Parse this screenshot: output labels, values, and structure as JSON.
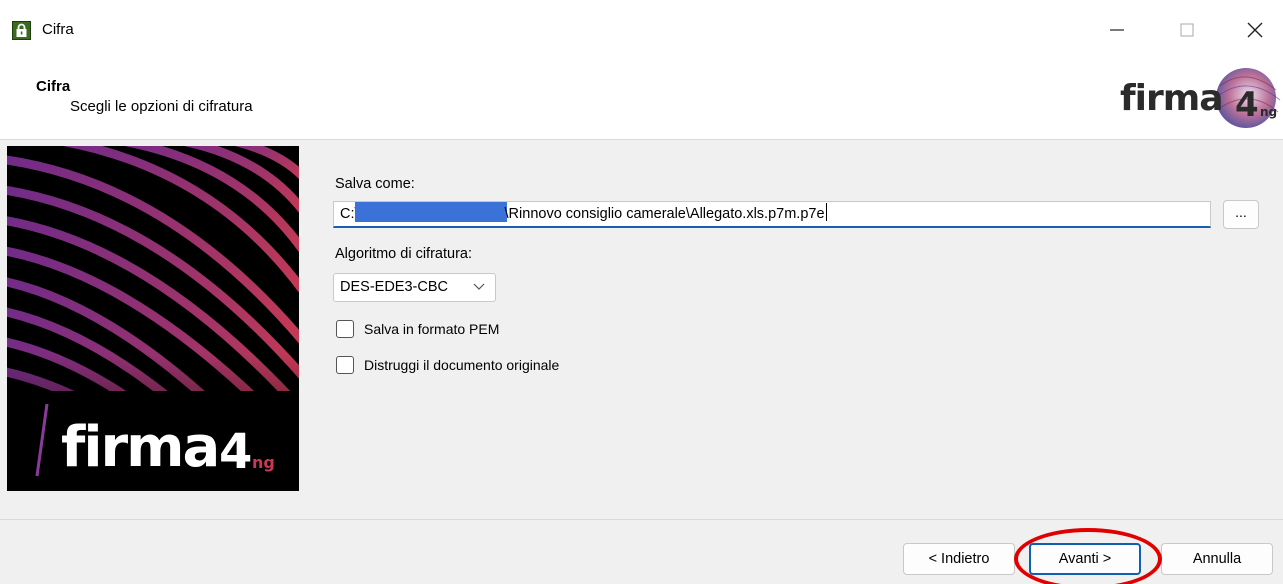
{
  "window": {
    "title": "Cifra",
    "icon": "padlock-icon",
    "controls": [
      "minimize-icon",
      "maximize-icon",
      "close-icon"
    ]
  },
  "header": {
    "title": "Cifra",
    "subtitle": "Scegli le opzioni di cifratura",
    "logo_text": "firma4ng"
  },
  "banner": {
    "logo_text": "firma4ng"
  },
  "form": {
    "save_as_label": "Salva come:",
    "path_prefix": "C:\\",
    "path_suffix": "\\Rinnovo consiglio camerale\\Allegato.xls.p7m.p7e",
    "browse_label": "...",
    "algorithm_label": "Algoritmo di cifratura:",
    "algorithm_value": "DES-EDE3-CBC",
    "pem_label": "Salva in formato PEM",
    "destroy_label": "Distruggi il documento originale"
  },
  "buttons": {
    "back": "< Indietro",
    "next": "Avanti >",
    "cancel": "Annulla"
  },
  "colors": {
    "accent": "#0f5fb5",
    "highlight": "#e00000",
    "redaction": "#3a72d8"
  }
}
